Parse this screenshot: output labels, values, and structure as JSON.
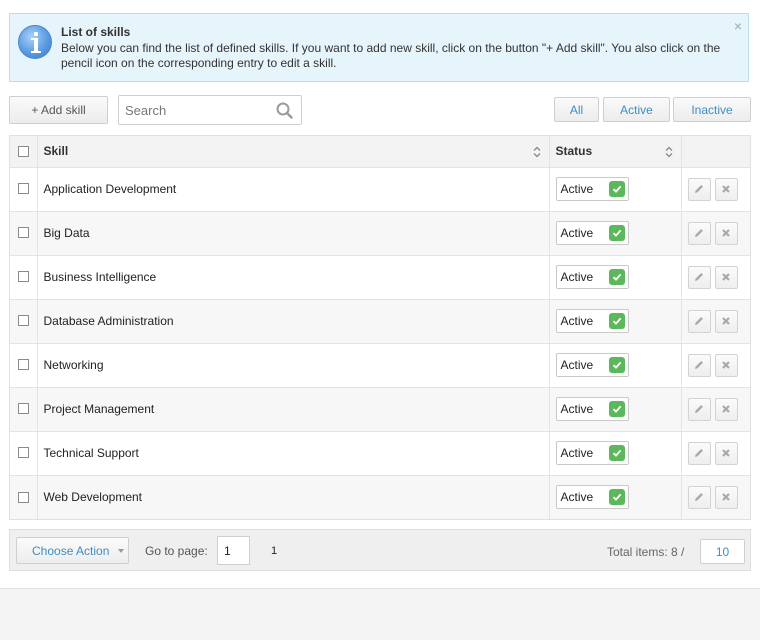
{
  "info": {
    "title": "List of skills",
    "text": "Below you can find the list of defined skills. If you want to add new skill, click on the button \"+ Add skill\". You also click on the pencil icon on the corresponding entry to edit a skill.",
    "close_glyph": "×"
  },
  "toolbar": {
    "add_label": "+ Add skill",
    "search_placeholder": "Search",
    "filters": {
      "all": "All",
      "active": "Active",
      "inactive": "Inactive"
    }
  },
  "table": {
    "headers": {
      "skill": "Skill",
      "status": "Status"
    },
    "rows": [
      {
        "skill": "Application Development",
        "status": "Active"
      },
      {
        "skill": "Big Data",
        "status": "Active"
      },
      {
        "skill": "Business Intelligence",
        "status": "Active"
      },
      {
        "skill": "Database Administration",
        "status": "Active"
      },
      {
        "skill": "Networking",
        "status": "Active"
      },
      {
        "skill": "Project Management",
        "status": "Active"
      },
      {
        "skill": "Technical Support",
        "status": "Active"
      },
      {
        "skill": "Web Development",
        "status": "Active"
      }
    ]
  },
  "footer": {
    "choose_action": "Choose Action",
    "goto_label": "Go to page:",
    "page_value": "1",
    "page_count": "1",
    "total_label": "Total items: 8 /",
    "per_page": "10"
  },
  "colors": {
    "accent": "#3e8dc4",
    "status_ok": "#5cb85c",
    "info_bg": "#e6f4fb"
  },
  "icons": {
    "info": "info-circle-icon",
    "search": "search-icon",
    "sort": "sort-icon",
    "check": "check-icon",
    "edit": "pencil-icon",
    "delete": "close-icon"
  }
}
